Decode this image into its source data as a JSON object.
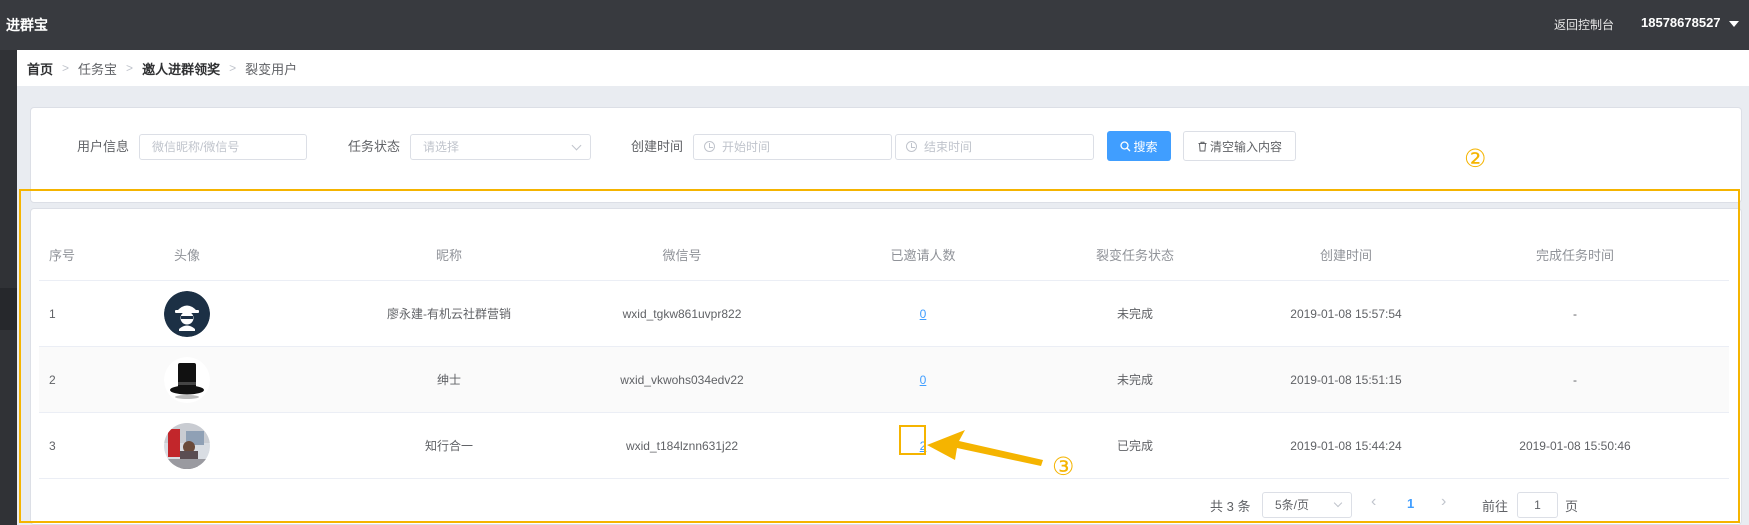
{
  "topbar": {
    "brand": "进群宝",
    "console_link": "返回控制台",
    "user_phone": "18578678527"
  },
  "breadcrumb": [
    "首页",
    "任务宝",
    "邀人进群领奖",
    "裂变用户"
  ],
  "filters": {
    "user_info_label": "用户信息",
    "user_info_placeholder": "微信昵称/微信号",
    "status_label": "任务状态",
    "status_placeholder": "请选择",
    "created_label": "创建时间",
    "start_placeholder": "开始时间",
    "end_placeholder": "结束时间",
    "search_button": "搜索",
    "clear_button": "清空输入内容"
  },
  "table": {
    "headers": [
      "序号",
      "头像",
      "昵称",
      "微信号",
      "已邀请人数",
      "裂变任务状态",
      "创建时间",
      "完成任务时间"
    ],
    "rows": [
      {
        "index": "1",
        "avatar": "hacker-avatar",
        "nickname": "廖永建-有机云社群营销",
        "wechat_id": "wxid_tgkw861uvpr822",
        "invited": "0",
        "status": "未完成",
        "created": "2019-01-08 15:57:54",
        "completed": "-"
      },
      {
        "index": "2",
        "avatar": "top-hat-avatar",
        "nickname": "绅士",
        "wechat_id": "wxid_vkwohs034edv22",
        "invited": "0",
        "status": "未完成",
        "created": "2019-01-08 15:51:15",
        "completed": "-"
      },
      {
        "index": "3",
        "avatar": "photo-avatar",
        "nickname": "知行合一",
        "wechat_id": "wxid_t184lznn631j22",
        "invited": "2",
        "status": "已完成",
        "created": "2019-01-08 15:44:24",
        "completed": "2019-01-08 15:50:46"
      }
    ]
  },
  "pagination": {
    "total": "共 3 条",
    "page_size": "5条/页",
    "current_page": "1",
    "goto_label": "前往",
    "goto_value": "1",
    "page_suffix": "页"
  },
  "annotations": {
    "marker_2": "②",
    "marker_3": "③",
    "color": "#f5b400"
  },
  "colors": {
    "topbar": "#383a3f",
    "primary": "#409eff"
  }
}
